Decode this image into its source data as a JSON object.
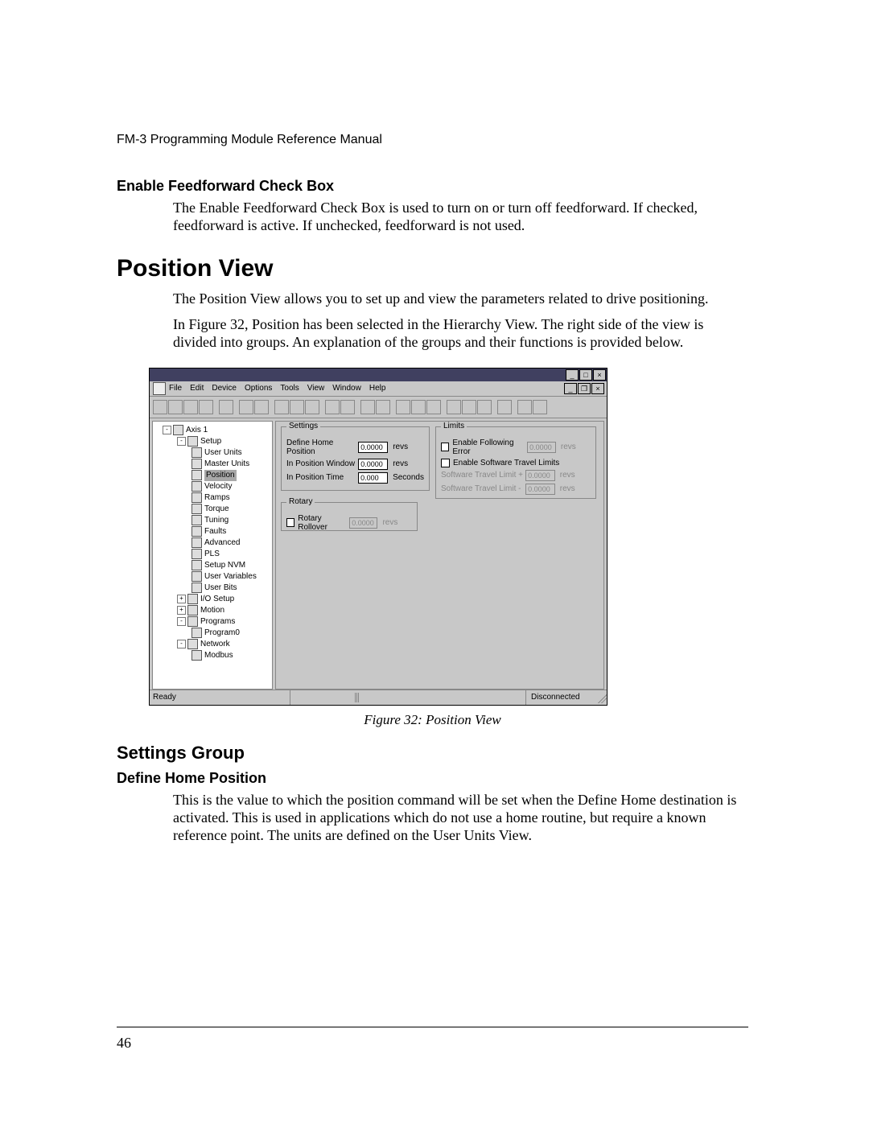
{
  "doc_header": "FM-3 Programming Module Reference Manual",
  "section1": {
    "title": "Enable Feedforward Check Box",
    "p1": "The Enable Feedforward Check Box is used to turn on or turn off feedforward. If checked, feedforward is active. If unchecked, feedforward is not used."
  },
  "heading_main": "Position View",
  "intro": {
    "p1": "The Position View allows you to set up and view the parameters related to drive positioning.",
    "p2": "In Figure 32, Position has been selected in the Hierarchy View. The right side of the view is divided into groups. An explanation of the groups and their functions is provided below."
  },
  "figure_caption": "Figure 32:    Position View",
  "section2_h2": "Settings Group",
  "section2": {
    "title": "Define Home Position",
    "p1": "This is the value to which the position command will be set when the Define Home destination is activated. This is used in applications which do not use a home routine, but require a known reference point. The units are defined on the User Units View."
  },
  "page_number": "46",
  "app": {
    "menu": [
      "File",
      "Edit",
      "Device",
      "Options",
      "Tools",
      "View",
      "Window",
      "Help"
    ],
    "win_buttons": {
      "min": "_",
      "max": "□",
      "close": "×"
    },
    "mdi_buttons": {
      "min": "_",
      "restore": "❐",
      "close": "×"
    },
    "tree": {
      "root": "Axis 1",
      "setup": "Setup",
      "items": [
        "User Units",
        "Master Units",
        "Position",
        "Velocity",
        "Ramps",
        "Torque",
        "Tuning",
        "Faults",
        "Advanced",
        "PLS",
        "Setup NVM",
        "User Variables",
        "User Bits"
      ],
      "io": "I/O Setup",
      "motion": "Motion",
      "programs": "Programs",
      "program0": "Program0",
      "network": "Network",
      "modbus": "Modbus"
    },
    "settings": {
      "group": "Settings",
      "home_label": "Define Home Position",
      "home_value": "0.0000",
      "home_unit": "revs",
      "window_label": "In Position Window",
      "window_value": "0.0000",
      "window_unit": "revs",
      "time_label": "In Position Time",
      "time_value": "0.000",
      "time_unit": "Seconds"
    },
    "rotary": {
      "group": "Rotary",
      "label": "Rotary Rollover",
      "value": "0.0000",
      "unit": "revs"
    },
    "limits": {
      "group": "Limits",
      "err_label": "Enable Following Error",
      "err_value": "0.0000",
      "err_unit": "revs",
      "stl_label": "Enable Software Travel Limits",
      "stl_plus_label": "Software Travel Limit +",
      "stl_plus_value": "0.0000",
      "stl_plus_unit": "revs",
      "stl_minus_label": "Software Travel Limit -",
      "stl_minus_value": "0.0000",
      "stl_minus_unit": "revs"
    },
    "status": {
      "left": "Ready",
      "right": "Disconnected"
    }
  }
}
